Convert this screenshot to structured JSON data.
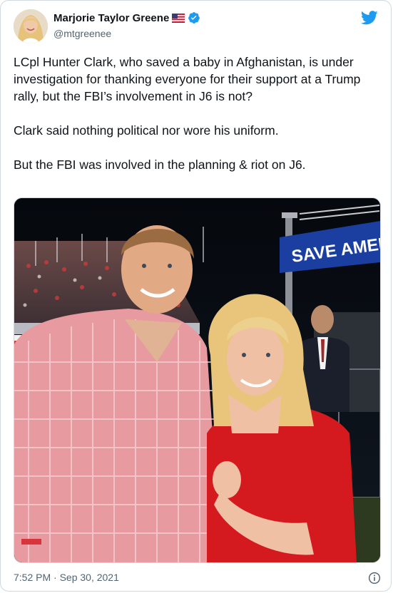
{
  "author": {
    "display_name": "Marjorie Taylor Greene",
    "handle": "@mtgreenee",
    "flag_icon": "us-flag-icon",
    "verified_icon": "verified-badge-icon",
    "avatar": "avatar"
  },
  "brand": {
    "icon": "twitter-bird-icon",
    "color": "#1d9bf0"
  },
  "tweet": {
    "paragraphs": [
      "LCpl Hunter Clark, who saved a baby in Afghanistan, is under investigation for thanking everyone for their support at a Trump rally, but the FBI’s involvement in J6 is not?",
      "Clark said nothing political nor wore his uniform.",
      "But the FBI was involved in the planning & riot on J6."
    ]
  },
  "media": {
    "banner_text": "SAVE AMER",
    "banner_color": "#1a3fa0"
  },
  "footer": {
    "timestamp": "7:52 PM · Sep 30, 2021",
    "info_icon": "info-icon"
  },
  "colors": {
    "text_primary": "#0f1419",
    "text_secondary": "#536471",
    "border": "#cfd9de",
    "verified": "#1d9bf0"
  }
}
